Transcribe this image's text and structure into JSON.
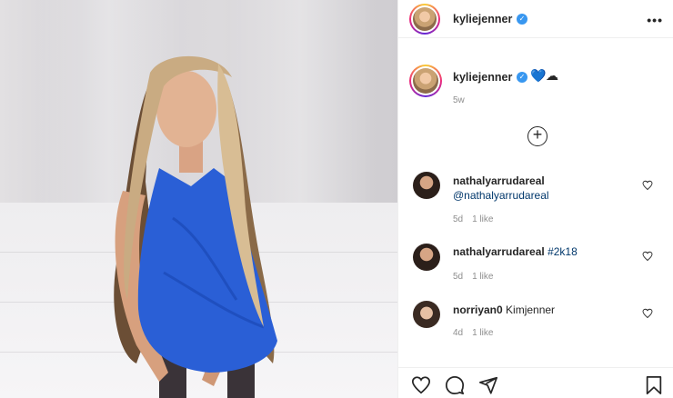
{
  "post": {
    "username": "kyliejenner",
    "caption_emoji": [
      "💙",
      "☁"
    ],
    "posted_ago": "5w"
  },
  "comments": [
    {
      "username": "nathalyarrudareal",
      "text": "@nathalyarrudareal",
      "text_is_mention": true,
      "age": "5d",
      "likes": "1 like"
    },
    {
      "username": "nathalyarrudareal",
      "text": "#2k18",
      "text_is_mention": true,
      "age": "5d",
      "likes": "1 like"
    },
    {
      "username": "norriyan0",
      "text": "Kimjenner",
      "text_is_mention": false,
      "age": "4d",
      "likes": "1 like"
    }
  ],
  "icons": {
    "verified": "verified-check-icon",
    "more": "more-options-icon",
    "load_more": "plus-circle-icon",
    "like": "heart-icon",
    "comment": "comment-icon",
    "share": "share-icon",
    "save": "bookmark-icon"
  },
  "colors": {
    "verified": "#3897f0",
    "mention": "#00376b",
    "muted": "#8e8e8e",
    "text": "#262626",
    "dress": "#2a5fd6"
  }
}
